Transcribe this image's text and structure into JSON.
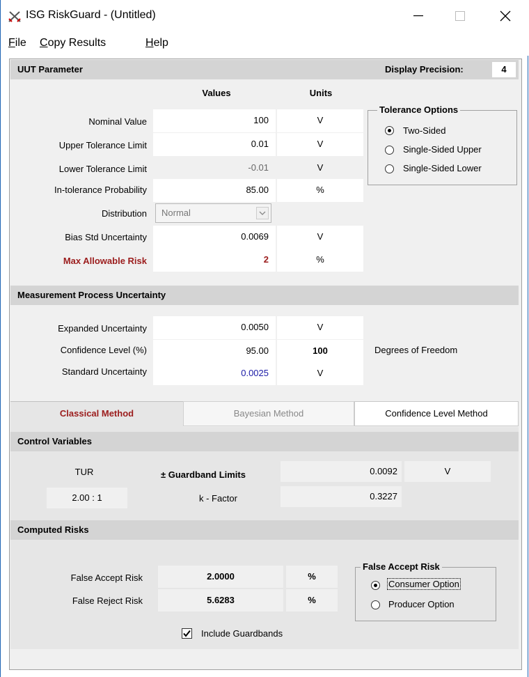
{
  "window": {
    "title": "ISG RiskGuard - (Untitled)",
    "minimize": "—",
    "close": "✕"
  },
  "menu": {
    "file": "File",
    "copy_results": "Copy Results",
    "help": "Help"
  },
  "uut": {
    "section_title": "UUT Parameter",
    "display_precision_label": "Display Precision:",
    "display_precision_value": "4",
    "col_values": "Values",
    "col_units": "Units",
    "rows": [
      {
        "label": "Nominal Value",
        "value": "100",
        "unit": "V"
      },
      {
        "label": "Upper Tolerance Limit",
        "value": "0.01",
        "unit": "V"
      },
      {
        "label": "Lower Tolerance Limit",
        "value": "-0.01",
        "unit": "V"
      },
      {
        "label": "In-tolerance Probability",
        "value": "85.00",
        "unit": "%"
      }
    ],
    "distribution_label": "Distribution",
    "distribution_value": "Normal",
    "bias_label": "Bias Std Uncertainty",
    "bias_value": "0.0069",
    "bias_unit": "V",
    "max_risk_label": "Max Allowable Risk",
    "max_risk_value": "2",
    "max_risk_unit": "%",
    "tolerance_options": {
      "title": "Tolerance Options",
      "options": [
        "Two-Sided",
        "Single-Sided Upper",
        "Single-Sided Lower"
      ],
      "selected": "Two-Sided"
    }
  },
  "mpu": {
    "section_title": "Measurement Process Uncertainty",
    "expanded_label": "Expanded Uncertainty",
    "expanded_value": "0.0050",
    "expanded_unit": "V",
    "confidence_label": "Confidence Level (%)",
    "confidence_value": "95.00",
    "dof_value": "100",
    "dof_label": "Degrees of Freedom",
    "standard_label": "Standard Uncertainty",
    "standard_value": "0.0025",
    "standard_unit": "V"
  },
  "tabs": {
    "classical": "Classical Method",
    "bayesian": "Bayesian Method",
    "confidence": "Confidence Level Method",
    "active": "Classical Method"
  },
  "control": {
    "section_title": "Control Variables",
    "tur_label": "TUR",
    "tur_value": "2.00 : 1",
    "guardband_label": "± Guardband Limits",
    "guardband_value": "0.0092",
    "guardband_unit": "V",
    "kfactor_label": "k - Factor",
    "kfactor_value": "0.3227"
  },
  "risks": {
    "section_title": "Computed Risks",
    "far_label": "False Accept Risk",
    "far_value": "2.0000",
    "far_unit": "%",
    "frr_label": "False Reject Risk",
    "frr_value": "5.6283",
    "frr_unit": "%",
    "include_guardbands": "Include Guardbands",
    "include_guardbands_checked": true,
    "option_group": {
      "title": "False Accept Risk",
      "options": [
        "Consumer Option",
        "Producer Option"
      ],
      "selected": "Consumer Option"
    }
  },
  "colors": {
    "accent_red": "#9b1c1c",
    "blue_value": "#1a1aa6",
    "section_bg": "#d4d4d4"
  }
}
